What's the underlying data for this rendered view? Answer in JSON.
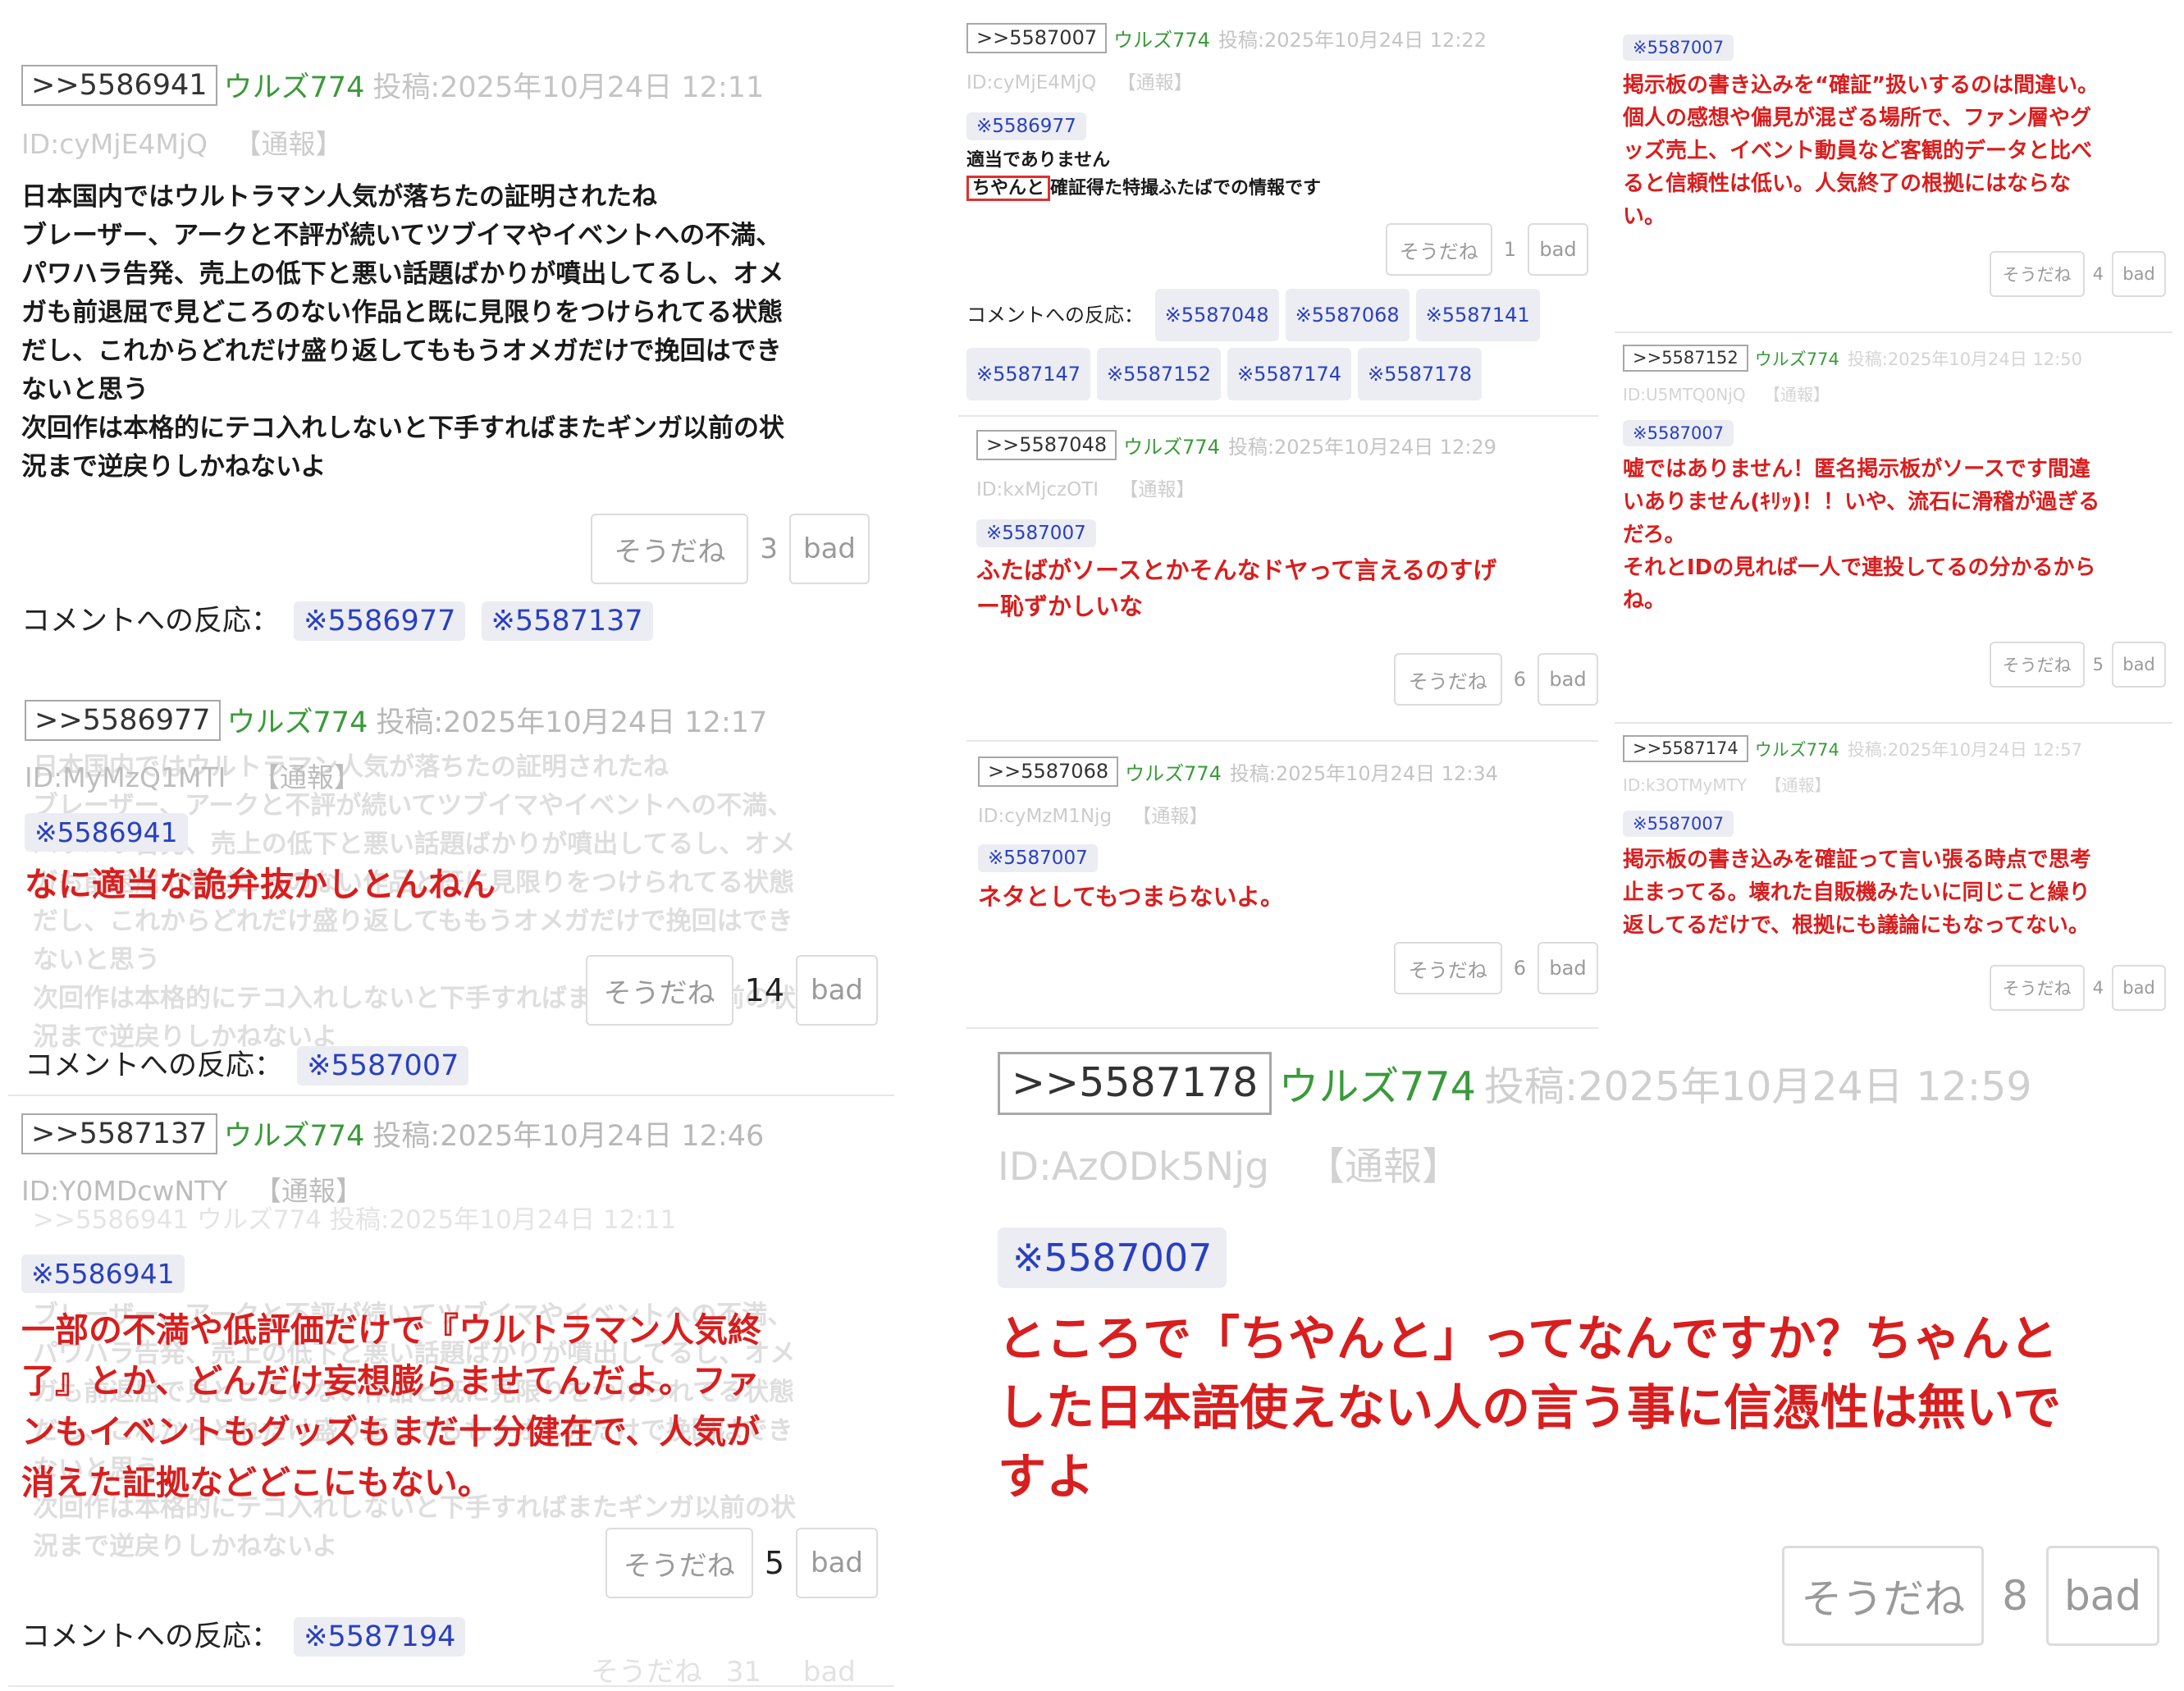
{
  "common": {
    "name": "ウルズ774",
    "souda": "そうだね",
    "bad": "bad",
    "report": "【通報】",
    "reactions_label": "コメントへの反応："
  },
  "posts": [
    {
      "num": ">>5586941",
      "posted": "投稿:2025年10月24日 12:11",
      "id": "ID:cyMjE4MjQ",
      "lines": [
        "日本国内ではウルトラマン人気が落ちたの証明されたね",
        "ブレーザー、アークと不評が続いてツブイマやイベントへの不満、",
        "パワハラ告発、売上の低下と悪い話題ばかりが噴出してるし、オメ",
        "ガも前退屈で見どころのない作品と既に見限りをつけられてる状態",
        "だし、これからどれだけ盛り返してももうオメガだけで挽回はでき",
        "ないと思う",
        "次回作は本格的にテコ入れしないと下手すればまたギンガ以前の状",
        "況まで逆戻りしかねないよ"
      ],
      "count": "3",
      "reactions": [
        "※5586977",
        "※5587137"
      ]
    },
    {
      "num": ">>5586977",
      "posted": "投稿:2025年10月24日 12:17",
      "id": "ID:MyMzQ1MTI",
      "ref": "※5586941",
      "lines": [
        "なに適当な詭弁抜かしとんねん"
      ],
      "count": "14",
      "reactions": [
        "※5587007"
      ]
    },
    {
      "num": ">>5587137",
      "posted": "投稿:2025年10月24日 12:46",
      "id": "ID:Y0MDcwNTY",
      "ref": "※5586941",
      "lines": [
        "一部の不満や低評価だけで『ウルトラマン人気終",
        "了』とか、どんだけ妄想膨らませてんだよ。ファ",
        "ンもイベントもグッズもまだ十分健在で、人気が",
        "消えた証拠などどこにもない。"
      ],
      "count": "5",
      "reactions": [
        "※5587194"
      ]
    },
    {
      "num": ">>5587007",
      "posted": "投稿:2025年10月24日 12:22",
      "id": "ID:cyMjE4MjQ",
      "ref": "※5586977",
      "line1": "適当でありません",
      "line2_boxed": "ちやんと",
      "line2_rest": "確証得た特撮ふたばでの情報です",
      "count": "1",
      "reactions": [
        "※5587048",
        "※5587068",
        "※5587141",
        "※5587147",
        "※5587152",
        "※5587174",
        "※5587178"
      ]
    },
    {
      "num": ">>5587048",
      "posted": "投稿:2025年10月24日 12:29",
      "id": "ID:kxMjczOTI",
      "ref": "※5587007",
      "lines": [
        "ふたばがソースとかそんなドヤって言えるのすげ",
        "ー恥ずかしいな"
      ],
      "count": "6"
    },
    {
      "num": ">>5587068",
      "posted": "投稿:2025年10月24日 12:34",
      "id": "ID:cyMzM1Njg",
      "ref": "※5587007",
      "lines": [
        "ネタとしてもつまらないよ。"
      ],
      "count": "6"
    },
    {
      "num": ">>5587178",
      "posted": "投稿:2025年10月24日 12:59",
      "id": "ID:AzODk5Njg",
      "ref": "※5587007",
      "lines": [
        "ところで「ちやんと」ってなんですか？ちゃんと",
        "した日本語使えない人の言う事に信憑性は無いで",
        "すよ"
      ],
      "count": "8"
    },
    {
      "ref": "※5587007",
      "lines": [
        "掲示板の書き込みを“確証”扱いするのは間違い。",
        "個人の感想や偏見が混ざる場所で、ファン層やグ",
        "ッズ売上、イベント動員など客観的データと比べ",
        "ると信頼性は低い。人気終了の根拠にはならな",
        "い。"
      ],
      "count": "4"
    },
    {
      "num": ">>5587152",
      "posted": "投稿:2025年10月24日 12:50",
      "id": "ID:U5MTQ0NjQ",
      "ref": "※5587007",
      "lines": [
        "嘘ではありません！匿名掲示板がソースです間違",
        "いありません(ｷﾘｯ)！！いや、流石に滑稽が過ぎる",
        "だろ。",
        "それとIDの見れば一人で連投してるの分かるから",
        "ね。"
      ],
      "count": "5"
    },
    {
      "num": ">>5587174",
      "posted": "投稿:2025年10月24日 12:57",
      "id": "ID:k3OTMyMTY",
      "ref": "※5587007",
      "lines": [
        "掲示板の書き込みを確証って言い張る時点で思考",
        "止まってる。壊れた自販機みたいに同じこと繰り",
        "返してるだけで、根拠にも議論にもなってない。"
      ],
      "count": "4"
    }
  ],
  "ghost": {
    "count_31": "31",
    "post_ref": ">>5586941 ウルズ774 投稿:2025年10月24日 12:11"
  }
}
